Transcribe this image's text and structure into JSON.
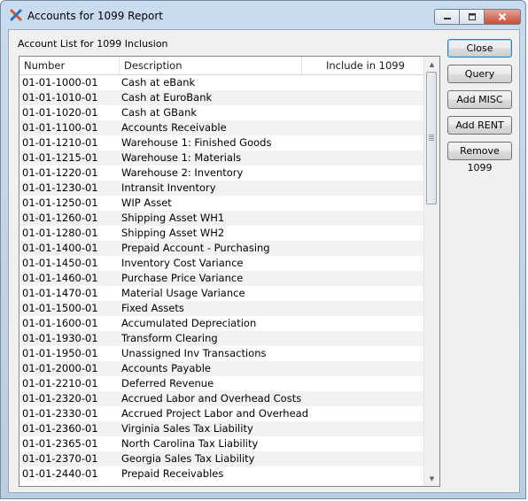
{
  "window": {
    "title": "Accounts for 1099 Report"
  },
  "list": {
    "label": "Account List for 1099 Inclusion",
    "columns": [
      "Number",
      "Description",
      "Include in 1099"
    ],
    "rows": [
      [
        "01-01-1000-01",
        "Cash at eBank",
        ""
      ],
      [
        "01-01-1010-01",
        "Cash at EuroBank",
        ""
      ],
      [
        "01-01-1020-01",
        "Cash at GBank",
        ""
      ],
      [
        "01-01-1100-01",
        "Accounts Receivable",
        ""
      ],
      [
        "01-01-1210-01",
        "Warehouse 1: Finished Goods",
        ""
      ],
      [
        "01-01-1215-01",
        "Warehouse 1: Materials",
        ""
      ],
      [
        "01-01-1220-01",
        "Warehouse 2: Inventory",
        ""
      ],
      [
        "01-01-1230-01",
        "Intransit Inventory",
        ""
      ],
      [
        "01-01-1250-01",
        "WIP Asset",
        ""
      ],
      [
        "01-01-1260-01",
        "Shipping Asset WH1",
        ""
      ],
      [
        "01-01-1280-01",
        "Shipping Asset WH2",
        ""
      ],
      [
        "01-01-1400-01",
        "Prepaid Account - Purchasing",
        ""
      ],
      [
        "01-01-1450-01",
        "Inventory Cost Variance",
        ""
      ],
      [
        "01-01-1460-01",
        "Purchase Price Variance",
        ""
      ],
      [
        "01-01-1470-01",
        "Material Usage Variance",
        ""
      ],
      [
        "01-01-1500-01",
        "Fixed Assets",
        ""
      ],
      [
        "01-01-1600-01",
        "Accumulated Depreciation",
        ""
      ],
      [
        "01-01-1930-01",
        "Transform Clearing",
        ""
      ],
      [
        "01-01-1950-01",
        "Unassigned Inv Transactions",
        ""
      ],
      [
        "01-01-2000-01",
        "Accounts Payable",
        ""
      ],
      [
        "01-01-2210-01",
        "Deferred Revenue",
        ""
      ],
      [
        "01-01-2320-01",
        "Accrued Labor and Overhead Costs",
        ""
      ],
      [
        "01-01-2330-01",
        "Accrued Project Labor and Overhead",
        ""
      ],
      [
        "01-01-2360-01",
        "Virginia Sales Tax Liability",
        ""
      ],
      [
        "01-01-2365-01",
        "North Carolina Tax Liability",
        ""
      ],
      [
        "01-01-2370-01",
        "Georgia Sales Tax Liability",
        ""
      ],
      [
        "01-01-2440-01",
        "Prepaid Receivables",
        ""
      ]
    ]
  },
  "buttons": {
    "close": "Close",
    "query": "Query",
    "add_misc": "Add MISC",
    "add_rent": "Add RENT",
    "remove_1099": "Remove 1099"
  },
  "colors": {
    "accent": "#3c7fb1",
    "title_close": "#c44e37"
  }
}
